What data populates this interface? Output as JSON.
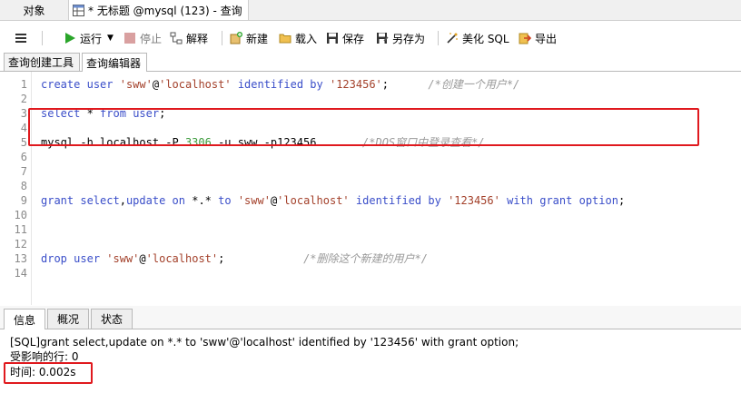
{
  "tabs": {
    "objects": "对象",
    "query": "* 无标题 @mysql (123) - 查询"
  },
  "toolbar": {
    "menu_icon": "hamburger-icon",
    "run": "运行",
    "stop": "停止",
    "explain": "解释",
    "new": "新建",
    "load": "载入",
    "save": "保存",
    "save_as": "另存为",
    "beautify": "美化 SQL",
    "export": "导出"
  },
  "subtabs": {
    "builder": "查询创建工具",
    "editor": "查询编辑器"
  },
  "editor": {
    "line_numbers": [
      "1",
      "2",
      "3",
      "4",
      "5",
      "6",
      "7",
      "8",
      "9",
      "10",
      "11",
      "12",
      "13",
      "14"
    ],
    "line1": {
      "kw1": "create",
      "kw2": "user",
      "s1": "'sww'",
      "at": "@",
      "s2": "'localhost'",
      "kw3": "identified",
      "kw4": "by",
      "s3": "'123456'",
      "end": ";",
      "comment": "/*创建一个用户*/"
    },
    "line3": {
      "kw1": "select",
      "mid": " * ",
      "kw2": "from",
      "kw3": "user",
      "end": ";"
    },
    "line5": {
      "a": "mysql -h localhost -P ",
      "num": "3306",
      "b": " -u sww -p123456",
      "comment": "/*DOS窗口中登录查看*/"
    },
    "line9": {
      "kw1": "grant",
      "kw2": "select",
      "comma": ",",
      "kw3": "update",
      "kw4": "on",
      "mid": " *.* ",
      "kw5": "to",
      "s1": "'sww'",
      "at": "@",
      "s2": "'localhost'",
      "kw6": "identified",
      "kw7": "by",
      "s3": "'123456'",
      "kw8": "with",
      "kw9": "grant",
      "kw10": "option",
      "end": ";"
    },
    "line13": {
      "kw1": "drop",
      "kw2": "user",
      "s1": "'sww'",
      "at": "@",
      "s2": "'localhost'",
      "end": ";",
      "comment": "/*删除这个新建的用户*/"
    }
  },
  "bottom_tabs": {
    "info": "信息",
    "profile": "概况",
    "status": "状态"
  },
  "output": {
    "sql": "[SQL]grant select,update on *.* to 'sww'@'localhost' identified by '123456' with grant option;",
    "affected": "受影响的行: 0",
    "time": "时间: 0.002s"
  },
  "colors": {
    "keyword": "#3a4ec9",
    "string": "#a3402a",
    "number": "#3a9a3a",
    "comment": "#9a9a9a",
    "highlight_box": "#e0191e"
  }
}
